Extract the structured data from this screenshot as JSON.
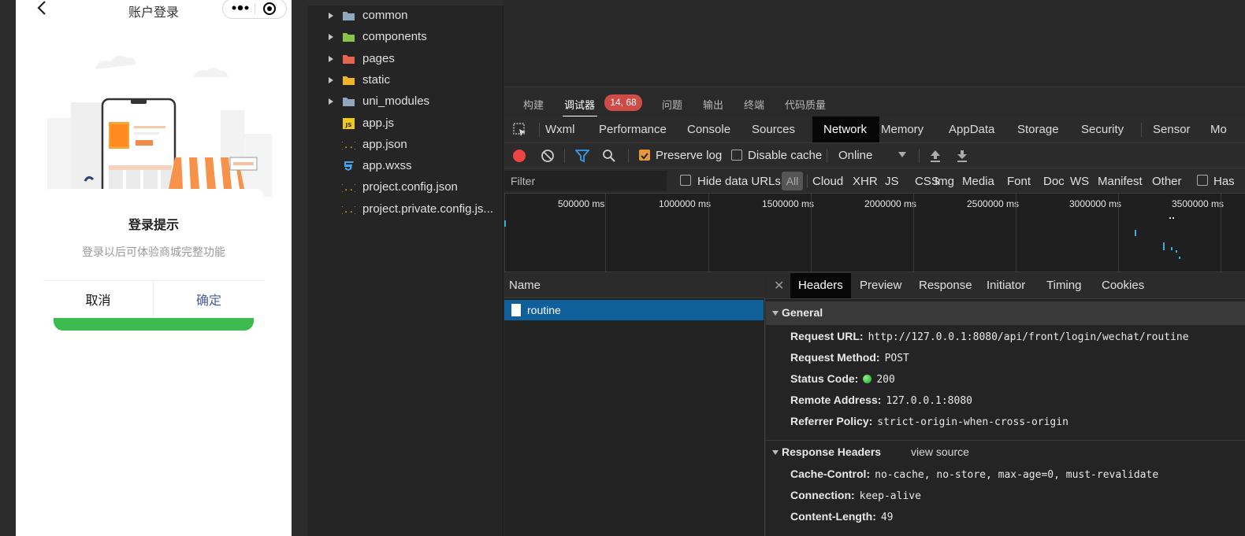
{
  "phone": {
    "nav_title": "账户登录",
    "modal": {
      "title": "登录提示",
      "content": "登录以后可体验商城完整功能",
      "cancel": "取消",
      "confirm": "确定"
    }
  },
  "file_tree": [
    {
      "label": "common",
      "icon": "folder-icon",
      "color": "#8fa7bf",
      "folder": true
    },
    {
      "label": "components",
      "icon": "components-folder-icon",
      "color": "#8bc34a",
      "folder": true
    },
    {
      "label": "pages",
      "icon": "pages-folder-icon",
      "color": "#e8644f",
      "folder": true
    },
    {
      "label": "static",
      "icon": "static-folder-icon",
      "color": "#f0b429",
      "folder": true
    },
    {
      "label": "uni_modules",
      "icon": "folder-icon",
      "color": "#8fa7bf",
      "folder": true
    },
    {
      "label": "app.js",
      "icon": "js-file-icon",
      "color": "#f0c91f",
      "folder": false
    },
    {
      "label": "app.json",
      "icon": "json-file-icon",
      "color": "#f0c91f",
      "folder": false
    },
    {
      "label": "app.wxss",
      "icon": "css-file-icon",
      "color": "#42a5f5",
      "folder": false
    },
    {
      "label": "project.config.json",
      "icon": "json-file-icon",
      "color": "#f0c91f",
      "folder": false
    },
    {
      "label": "project.private.config.js...",
      "icon": "json-file-icon",
      "color": "#f0c91f",
      "folder": false
    }
  ],
  "main_tabs": {
    "build": "构建",
    "debugger": "调试器",
    "badge": "14, 68",
    "issues": "问题",
    "output": "输出",
    "terminal": "终端",
    "code_quality": "代码质量"
  },
  "panel_tabs": [
    "Wxml",
    "Performance",
    "Console",
    "Sources",
    "Network",
    "Memory",
    "AppData",
    "Storage",
    "Security",
    "Sensor",
    "Mo"
  ],
  "toolbar": {
    "preserve_log": "Preserve log",
    "preserve_log_checked": true,
    "disable_cache": "Disable cache",
    "disable_cache_checked": false,
    "throttling": "Online"
  },
  "filter_bar": {
    "placeholder": "Filter",
    "hide_data_urls": "Hide data URLs",
    "types": [
      "All",
      "Cloud",
      "XHR",
      "JS",
      "CSS",
      "Img",
      "Media",
      "Font",
      "Doc",
      "WS",
      "Manifest",
      "Other"
    ],
    "has_blocked": "Has"
  },
  "overview": {
    "ticks": [
      "500000 ms",
      "1000000 ms",
      "1500000 ms",
      "2000000 ms",
      "2500000 ms",
      "3000000 ms",
      "3500000 ms"
    ]
  },
  "requests": {
    "name_header": "Name",
    "rows": [
      {
        "name": "routine"
      }
    ]
  },
  "details": {
    "tabs": [
      "Headers",
      "Preview",
      "Response",
      "Initiator",
      "Timing",
      "Cookies"
    ],
    "general_title": "General",
    "general": [
      {
        "key": "Request URL:",
        "value": "http://127.0.0.1:8080/api/front/login/wechat/routine"
      },
      {
        "key": "Request Method:",
        "value": "POST"
      },
      {
        "key": "Status Code:",
        "value": "200"
      },
      {
        "key": "Remote Address:",
        "value": "127.0.0.1:8080"
      },
      {
        "key": "Referrer Policy:",
        "value": "strict-origin-when-cross-origin"
      }
    ],
    "response_title": "Response Headers",
    "view_source": "view source",
    "response": [
      {
        "key": "Cache-Control:",
        "value": "no-cache, no-store, max-age=0, must-revalidate"
      },
      {
        "key": "Connection:",
        "value": "keep-alive"
      },
      {
        "key": "Content-Length:",
        "value": "49"
      }
    ],
    "status_color": "#2ecc2e"
  },
  "colors": {
    "selected_row": "#0e5f9a",
    "record": "#ee4444",
    "badge": "#d04b45",
    "confirm_text": "#4a5d9a",
    "login_button": "#3dbb4f"
  }
}
